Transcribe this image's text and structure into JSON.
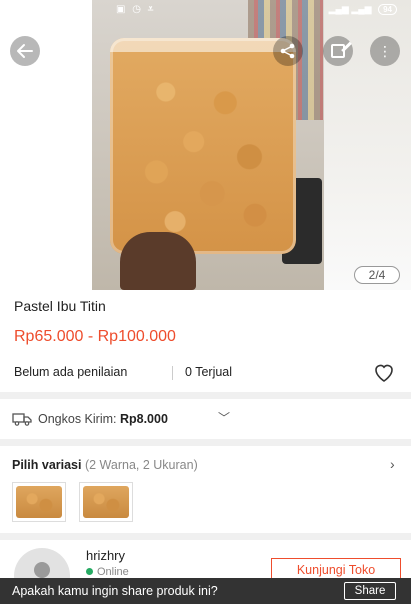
{
  "status_bar": {
    "time": "7:38",
    "speed": "1,4KB/d",
    "battery": "94"
  },
  "gallery": {
    "counter": "2/4"
  },
  "product": {
    "title": "Pastel Ibu Titin",
    "price": "Rp65.000 - Rp100.000",
    "rating_text": "Belum ada penilaian",
    "sold_text": "0 Terjual"
  },
  "shipping": {
    "label": "Ongkos Kirim: ",
    "value": "Rp8.000"
  },
  "variant": {
    "title": "Pilih variasi",
    "subtitle": "(2 Warna, 2 Ukuran)"
  },
  "shop": {
    "name": "hrizhry",
    "status": "Online",
    "visit_label": "Kunjungi Toko"
  },
  "snackbar": {
    "message": "Apakah kamu ingin share produk ini?",
    "action": "Share"
  },
  "colors": {
    "accent": "#ee4d2d",
    "online": "#26aa63"
  },
  "icons": [
    "back-arrow-icon",
    "share-icon",
    "edit-icon",
    "more-icon",
    "heart-icon",
    "truck-icon",
    "chevron-down-icon",
    "chevron-right-icon"
  ]
}
